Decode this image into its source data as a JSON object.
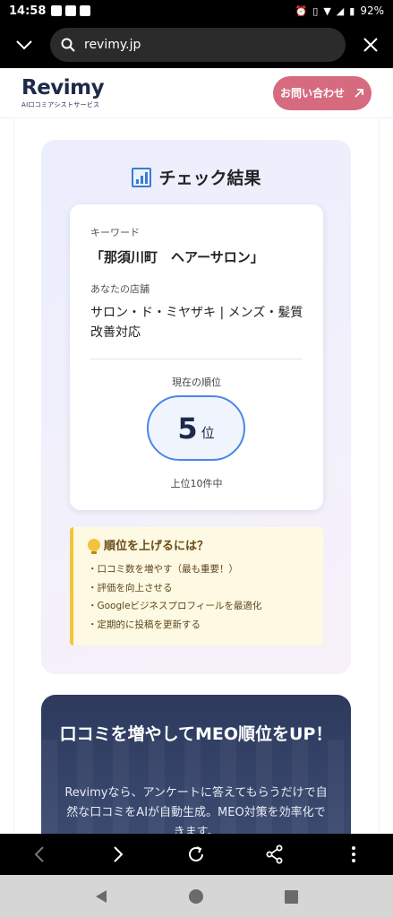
{
  "status_bar": {
    "time": "14:58",
    "battery": "92%"
  },
  "browser": {
    "url": "revimy.jp"
  },
  "site_header": {
    "logo_name": "Revimy",
    "logo_tagline": "AI口コミアシストサービス",
    "contact_label": "お問い合わせ"
  },
  "result": {
    "title": "チェック結果",
    "keyword_label": "キーワード",
    "keyword_value": "「那須川町　ヘアーサロン」",
    "shop_label": "あなたの店舗",
    "shop_value": "サロン・ド・ミヤザキ | メンズ・髪質改善対応",
    "rank_label": "現在の順位",
    "rank_number": "5",
    "rank_unit": "位",
    "rank_range": "上位10件中"
  },
  "tips": {
    "heading": "順位を上げるには？",
    "items": [
      "・口コミ数を増やす（最も重要！）",
      "・評価を向上させる",
      "・Googleビジネスプロフィールを最適化",
      "・定期的に投稿を更新する"
    ]
  },
  "promo": {
    "title": "口コミを増やしてMEO順位をUP！",
    "body": "Revimyなら、アンケートに答えてもらうだけで自然な口コミをAIが自動生成。MEO対策を効率化できます。"
  },
  "colors": {
    "contact_button": "#d66a7f",
    "rank_border": "#4a86e8",
    "tips_accent": "#f3c43b",
    "promo_bg": "#2d3a5e"
  }
}
